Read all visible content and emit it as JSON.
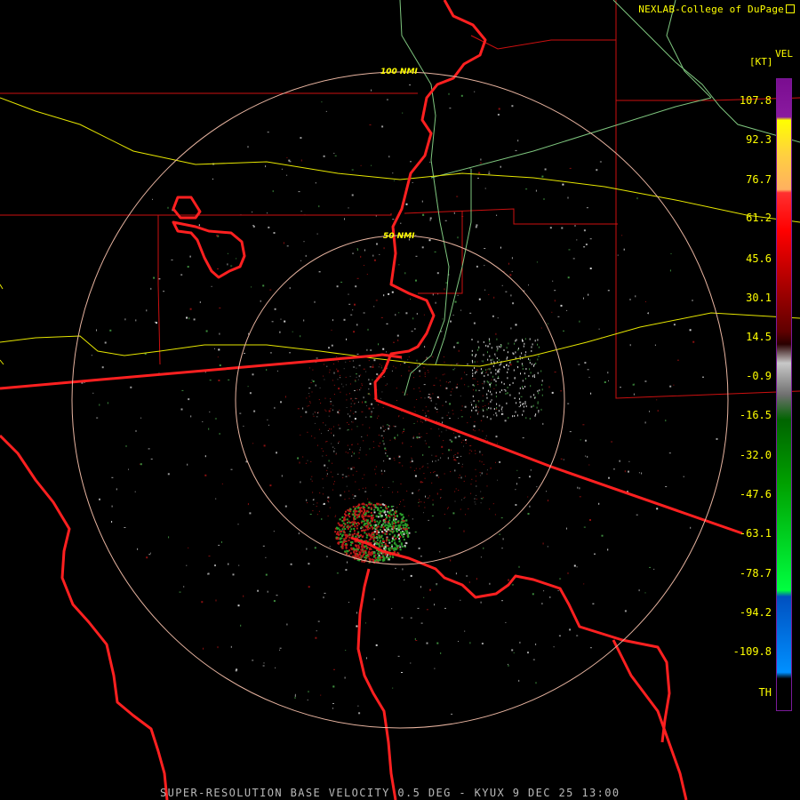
{
  "credit": "NEXLAB-College of DuPage",
  "credit_icon": "external-link-icon",
  "footer": "SUPER-RESOLUTION BASE VELOCITY 0.5 DEG - KYUX 9 DEC 25 13:00",
  "legend": {
    "title": "VEL",
    "unit": "[KT]",
    "ticks": [
      "107.8",
      "92.3",
      "76.7",
      "61.2",
      "45.6",
      "30.1",
      "14.5",
      "-0.9",
      "-16.5",
      "-32.0",
      "-47.6",
      "-63.1",
      "-78.7",
      "-94.2",
      "-109.8",
      "TH"
    ]
  },
  "rings": [
    "100 NMI",
    "50 NMI"
  ],
  "colors": {
    "state_borders": "#ff2020",
    "county_lines": "#cc1010",
    "highways": "#e6e600",
    "rivers": "#7fc77f",
    "range_rings": "#e8b4a0",
    "labels": "#ffff00"
  }
}
